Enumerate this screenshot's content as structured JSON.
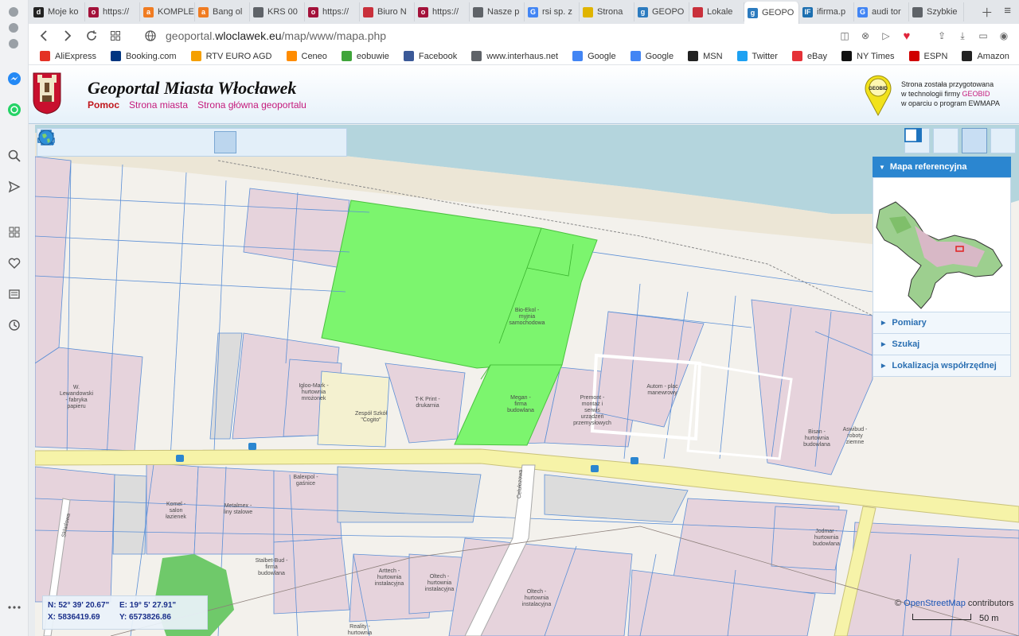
{
  "browser": {
    "tabs": [
      {
        "title": "Moje ko",
        "favicon": "d",
        "color": "#222222"
      },
      {
        "title": "https://",
        "favicon": "o",
        "color": "#a3123a"
      },
      {
        "title": "KOMPLE",
        "favicon": "a",
        "color": "#f07c22"
      },
      {
        "title": "Bang ol",
        "favicon": "a",
        "color": "#f07c22"
      },
      {
        "title": "KRS 00",
        "favicon": "doc",
        "color": "#5f6368"
      },
      {
        "title": "https://",
        "favicon": "o",
        "color": "#a3123a"
      },
      {
        "title": "Biuro N",
        "favicon": "flag",
        "color": "#c9303b"
      },
      {
        "title": "https://",
        "favicon": "o",
        "color": "#a3123a"
      },
      {
        "title": "Nasze p",
        "favicon": "doc",
        "color": "#5f6368"
      },
      {
        "title": "rsi sp. z",
        "favicon": "G",
        "color": "#4285f4"
      },
      {
        "title": "Strona",
        "favicon": "sun",
        "color": "#e0b400"
      },
      {
        "title": "GEOPO",
        "favicon": "g",
        "color": "#2c7bbf"
      },
      {
        "title": "Lokale",
        "favicon": "flag",
        "color": "#c9303b"
      },
      {
        "title": "GEOPO",
        "favicon": "g",
        "color": "#2c7bbf",
        "active": true
      },
      {
        "title": "ifirma.p",
        "favicon": "IF",
        "color": "#1c6fb0"
      },
      {
        "title": "audi tor",
        "favicon": "G",
        "color": "#4285f4"
      },
      {
        "title": "Szybkie",
        "favicon": "grid",
        "color": "#5f6368"
      }
    ],
    "url_prefix": "geoportal.",
    "url_domain": "wloclawek.eu",
    "url_path": "/map/www/mapa.php",
    "bookmarks": [
      {
        "label": "AliExpress",
        "icon": "aliexpress-icon",
        "color": "#e43225"
      },
      {
        "label": "Booking.com",
        "icon": "booking-icon",
        "color": "#003580"
      },
      {
        "label": "RTV EURO AGD",
        "icon": "rtv-euro-icon",
        "color": "#f5a000"
      },
      {
        "label": "Ceneo",
        "icon": "ceneo-icon",
        "color": "#ff8c00"
      },
      {
        "label": "eobuwie",
        "icon": "eobuwie-icon",
        "color": "#3fa43a"
      },
      {
        "label": "Facebook",
        "icon": "facebook-icon",
        "color": "#3b5998"
      },
      {
        "label": "www.interhaus.net",
        "icon": "folder-icon",
        "color": "#5f6368"
      },
      {
        "label": "Google",
        "icon": "google-icon",
        "color": "#4285f4"
      },
      {
        "label": "Google",
        "icon": "google-icon",
        "color": "#4285f4"
      },
      {
        "label": "MSN",
        "icon": "msn-icon",
        "color": "#222222"
      },
      {
        "label": "Twitter",
        "icon": "twitter-icon",
        "color": "#1da1f2"
      },
      {
        "label": "eBay",
        "icon": "ebay-icon",
        "color": "#e53238"
      },
      {
        "label": "NY Times",
        "icon": "nytimes-icon",
        "color": "#111111"
      },
      {
        "label": "ESPN",
        "icon": "espn-icon",
        "color": "#d00000"
      },
      {
        "label": "Amazon",
        "icon": "amazon-icon",
        "color": "#222222"
      }
    ]
  },
  "portal": {
    "title": "Geoportal Miasta Włocławek",
    "links": {
      "help": "Pomoc",
      "city": "Strona miasta",
      "main": "Strona główna geoportalu"
    },
    "geobid": {
      "logo_text": "GEOBID",
      "line1": "Strona została przygotowana",
      "line2_prefix": "w technologii firmy ",
      "line2_brand": "GEOBID",
      "line3": "w oparciu o program EWMAPA"
    }
  },
  "map": {
    "labels": [
      {
        "id": "w-lewandowski",
        "text": "W.\nLewandowski\n- fabryka\npapieru"
      },
      {
        "id": "igloo-mark",
        "text": "Igloo-Mark -\nhurtownia\nmrożonek"
      },
      {
        "id": "zespol-szkol",
        "text": "Zespół Szkół\n\"Cogito\""
      },
      {
        "id": "tk-print",
        "text": "T-K Print -\ndrukarnia"
      },
      {
        "id": "bio-ekol",
        "text": "Bio-Ekol -\nmyjnia\nsamochodowa"
      },
      {
        "id": "megan",
        "text": "Megan -\nfirma\nbudowlana"
      },
      {
        "id": "premont",
        "text": "Premont -\nmontaż i\nserwis\nurządzeń\nprzemysłowych"
      },
      {
        "id": "autom",
        "text": "Autom - plac\nmanewrowy"
      },
      {
        "id": "bisan",
        "text": "Bisan -\nhurtownia\nbudowlana"
      },
      {
        "id": "aswibud",
        "text": "Aswibud -\nroboty\nziemne"
      },
      {
        "id": "balexpol",
        "text": "Balexpol -\ngaśnice"
      },
      {
        "id": "komel",
        "text": "Komel -\nsalon\nłazienek"
      },
      {
        "id": "metalmex",
        "text": "Metalmex -\nliny stalowe"
      },
      {
        "id": "stalbet",
        "text": "Stalbet-Bud -\nfirma\nbudowlana"
      },
      {
        "id": "artech",
        "text": "Arttech -\nhurtownia\ninstalacyjna"
      },
      {
        "id": "oltech-1",
        "text": "Oltech -\nhurtownia\ninstalacyjna"
      },
      {
        "id": "oltech-2",
        "text": "Oltech -\nhurtownia\ninstalacyjna"
      },
      {
        "id": "jodmar",
        "text": "Jodmar -\nhurtownia\nbudowlana"
      },
      {
        "id": "reality",
        "text": "Reality -\nhurtownia"
      },
      {
        "id": "celulozowa",
        "text": "Celulozowa"
      },
      {
        "id": "skladowa",
        "text": "Składowa"
      }
    ],
    "side_panel": {
      "reference_title": "Mapa referencyjna",
      "items": [
        "Pomiary",
        "Szukaj",
        "Lokalizacja współrzędnej"
      ]
    },
    "coords": {
      "n_label": "N:",
      "n_value": "52° 39' 20.67\"",
      "e_label": "E:",
      "e_value": "19° 5' 27.91\"",
      "x_label": "X:",
      "x_value": "5836419.69",
      "y_label": "Y:",
      "y_value": "6573826.86"
    },
    "attribution": {
      "symbol": "©",
      "link": "OpenStreetMap",
      "suffix": " contributors"
    },
    "scale_label": "50 m"
  },
  "colors": {
    "parcel_green": "#7cf56e",
    "building_pink": "#e6d3dc",
    "road_yellow": "#f6f3a8",
    "water": "#b4d5dd",
    "panel_blue": "#2b86d0"
  }
}
